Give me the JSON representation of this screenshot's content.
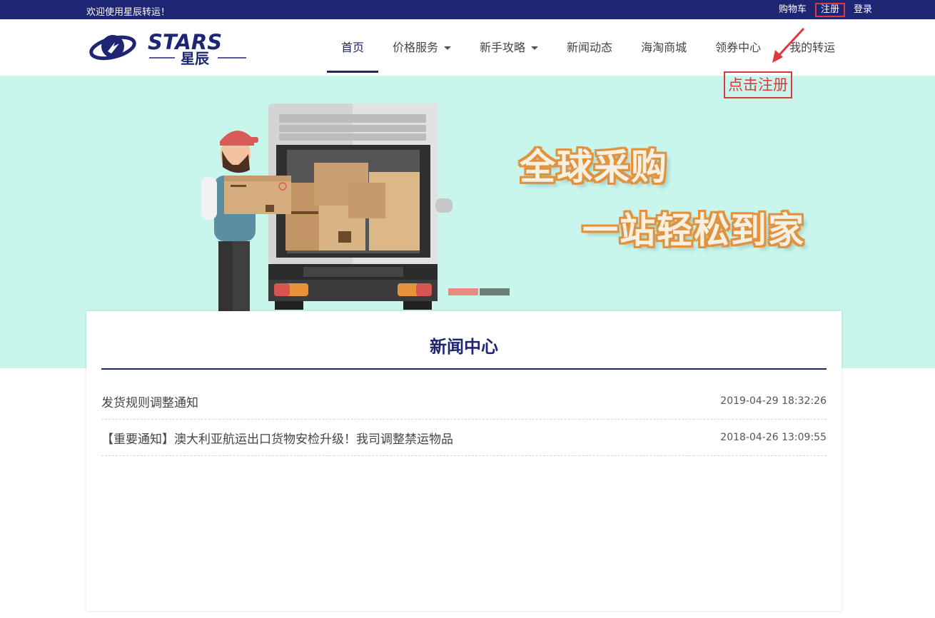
{
  "topbar": {
    "welcome": "欢迎使用星辰转运！",
    "cart": "购物车",
    "register": "注册",
    "login": "登录"
  },
  "logo": {
    "brand": "STARS",
    "sub": "星辰"
  },
  "nav": {
    "items": [
      {
        "label": "首页",
        "active": true
      },
      {
        "label": "价格服务",
        "dropdown": true
      },
      {
        "label": "新手攻略",
        "dropdown": true
      },
      {
        "label": "新闻动态"
      },
      {
        "label": "海淘商城"
      },
      {
        "label": "领券中心"
      },
      {
        "label": "我的转运"
      }
    ]
  },
  "annotation": {
    "label": "点击注册",
    "color": "#e0363e"
  },
  "banner": {
    "slogan_line1": "全球采购",
    "slogan_line2": "一站轻松到家",
    "background": "#c8f6ec",
    "dots": [
      {
        "color": "#e88a7e",
        "active": true
      },
      {
        "color": "#6d7f74",
        "active": false
      }
    ]
  },
  "news": {
    "title": "新闻中心",
    "items": [
      {
        "title": "发货规则调整通知",
        "date": "2019-04-29 18:32:26"
      },
      {
        "title": "【重要通知】澳大利亚航运出口货物安检升级！我司调整禁运物品",
        "date": "2018-04-26 13:09:55"
      }
    ]
  },
  "colors": {
    "brand": "#1e2573",
    "highlight": "#e0363e"
  }
}
